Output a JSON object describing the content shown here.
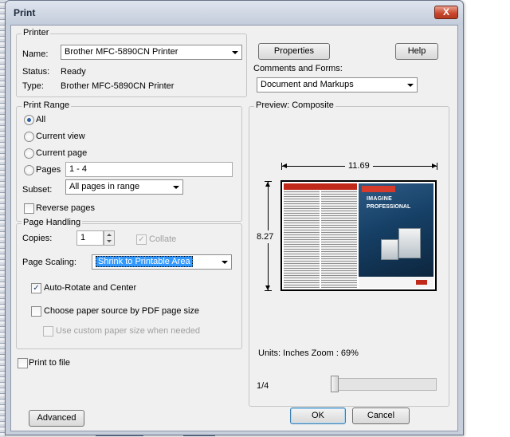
{
  "window": {
    "title": "Print",
    "close_glyph": "X"
  },
  "printer": {
    "group_label": "Printer",
    "name_label": "Name:",
    "name_value": "Brother MFC-5890CN Printer",
    "status_label": "Status:",
    "status_value": "Ready",
    "type_label": "Type:",
    "type_value": "Brother MFC-5890CN Printer",
    "properties_button": "Properties",
    "help_button": "Help",
    "comments_label": "Comments and Forms:",
    "comments_value": "Document and Markups"
  },
  "print_range": {
    "group_label": "Print Range",
    "options": [
      {
        "label": "All",
        "selected": true
      },
      {
        "label": "Current view",
        "selected": false
      },
      {
        "label": "Current page",
        "selected": false
      },
      {
        "label": "Pages",
        "selected": false
      }
    ],
    "pages_value": "1 - 4",
    "subset_label": "Subset:",
    "subset_value": "All pages in range",
    "reverse_label": "Reverse pages",
    "reverse_checked": false
  },
  "page_handling": {
    "group_label": "Page Handling",
    "copies_label": "Copies:",
    "copies_value": "1",
    "collate_label": "Collate",
    "collate_checked": true,
    "scaling_label": "Page Scaling:",
    "scaling_value": "Shrink to Printable Area",
    "auto_rotate_label": "Auto-Rotate and Center",
    "auto_rotate_checked": true,
    "choose_source_label": "Choose paper source by PDF page size",
    "choose_source_checked": false,
    "custom_size_label": "Use custom paper size when needed",
    "custom_size_checked": false
  },
  "print_to_file_label": "Print to file",
  "print_to_file_checked": false,
  "preview": {
    "label": "Preview: Composite",
    "width_value": "11.69",
    "height_value": "8.27",
    "brochure_headline": "IMAGINE",
    "brochure_subhead": "PROFESSIONAL",
    "units_zoom": "Units: Inches Zoom :  69%",
    "page_indicator": "1/4"
  },
  "buttons": {
    "advanced": "Advanced",
    "ok": "OK",
    "cancel": "Cancel"
  },
  "colors": {
    "title_bar": "#c7cfdd",
    "close": "#c8452a",
    "dialog_bg": "#f0f0f0",
    "selection": "#3399ff"
  }
}
